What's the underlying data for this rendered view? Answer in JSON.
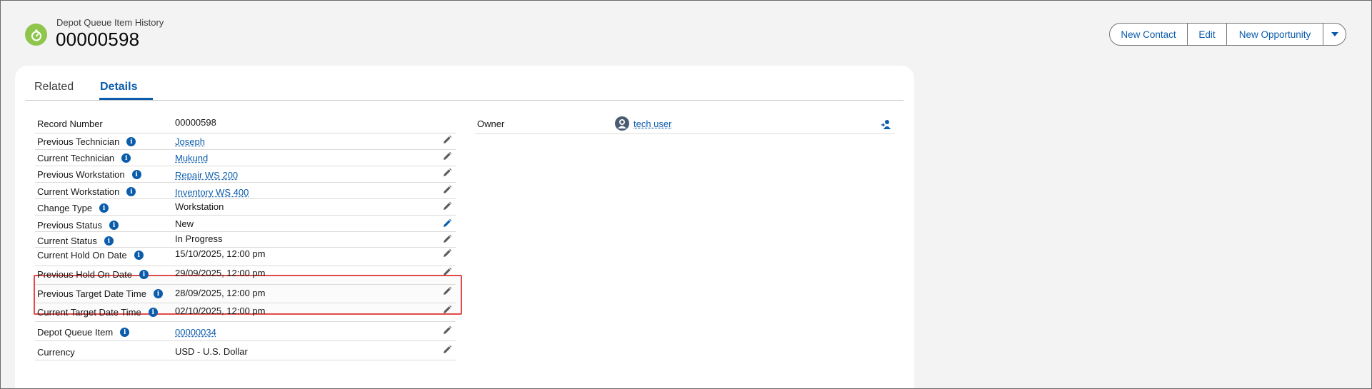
{
  "header": {
    "object_label": "Depot Queue Item History",
    "record_title": "00000598",
    "icon": "stopwatch-icon"
  },
  "actions": {
    "new_contact": "New Contact",
    "edit": "Edit",
    "new_opportunity": "New Opportunity",
    "more_icon": "chevron-down-icon"
  },
  "tabs": {
    "related": "Related",
    "details": "Details",
    "active": "Details"
  },
  "fields": [
    {
      "label": "Record Number",
      "value": "00000598",
      "link": false,
      "info": false,
      "editable": false
    },
    {
      "label": "Previous Technician",
      "value": "Joseph",
      "link": true,
      "info": true,
      "editable": true
    },
    {
      "label": "Current Technician",
      "value": "Mukund",
      "link": true,
      "info": true,
      "editable": true
    },
    {
      "label": "Previous Workstation",
      "value": "Repair WS 200",
      "link": true,
      "info": true,
      "editable": true
    },
    {
      "label": "Current Workstation",
      "value": "Inventory WS 400",
      "link": true,
      "info": true,
      "editable": true
    },
    {
      "label": "Change Type",
      "value": "Workstation",
      "link": false,
      "info": true,
      "editable": true
    },
    {
      "label": "Previous Status",
      "value": "New",
      "link": false,
      "info": true,
      "editable": true
    },
    {
      "label": "Current Status",
      "value": "In Progress",
      "link": false,
      "info": true,
      "editable": true
    },
    {
      "label": "Current Hold On Date",
      "value": "15/10/2025, 12:00 pm",
      "link": false,
      "info": true,
      "editable": true
    },
    {
      "label": "Previous Hold On Date",
      "value": "29/09/2025, 12:00 pm",
      "link": false,
      "info": true,
      "editable": true
    },
    {
      "label": "Previous Target Date Time",
      "value": "28/09/2025, 12:00 pm",
      "link": false,
      "info": true,
      "editable": true
    },
    {
      "label": "Current Target Date Time",
      "value": "02/10/2025, 12:00 pm",
      "link": false,
      "info": true,
      "editable": true
    },
    {
      "label": "Depot Queue Item",
      "value": "00000034",
      "link": true,
      "info": true,
      "editable": true
    },
    {
      "label": "Currency",
      "value": "USD - U.S. Dollar",
      "link": false,
      "info": false,
      "editable": true
    }
  ],
  "owner": {
    "label": "Owner",
    "value": "tech user"
  },
  "colors": {
    "brand_blue": "#0b5cab",
    "icon_green": "#8fc54c",
    "highlight_red": "#e24a4a"
  }
}
